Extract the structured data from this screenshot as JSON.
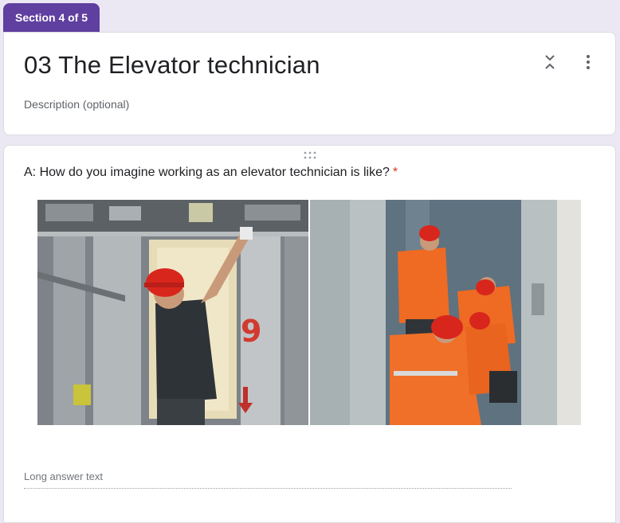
{
  "section": {
    "tab_label": "Section 4 of 5"
  },
  "header": {
    "title": "03 The Elevator technician",
    "description_placeholder": "Description (optional)",
    "collapse_icon": "expand-collapse-icon",
    "more_icon": "more-vert-icon"
  },
  "question": {
    "text": "A: How do you imagine working as an elevator technician is like?",
    "required_marker": "*",
    "answer_placeholder": "Long answer text",
    "drag_icon": "drag-handle-icon",
    "images": [
      "technician-reaching-in-elevator-shaft",
      "technicians-team-in-orange-jackets"
    ],
    "floor_number": "9"
  },
  "colors": {
    "accent": "#5f3f9f",
    "background": "#ebe8f4",
    "required": "#d93025"
  }
}
